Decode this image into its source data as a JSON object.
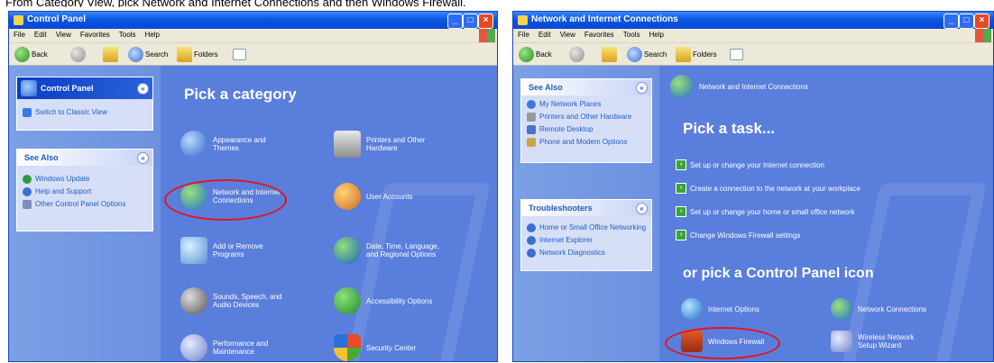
{
  "caption": "From Category View, pick Network and Internet Connections and then Windows Firewall.",
  "colors": {
    "xp_blue": "#5a7edc",
    "title_blue": "#0a56e0",
    "highlight_red": "#e3141e"
  },
  "left_window": {
    "title": "Control Panel",
    "menu": [
      "File",
      "Edit",
      "View",
      "Favorites",
      "Tools",
      "Help"
    ],
    "toolbar": {
      "back": "Back",
      "search": "Search",
      "folders": "Folders"
    },
    "control_panel_box": {
      "title": "Control Panel",
      "items": [
        "Switch to Classic View"
      ]
    },
    "see_also": {
      "title": "See Also",
      "items": [
        "Windows Update",
        "Help and Support",
        "Other Control Panel Options"
      ]
    },
    "heading": "Pick a category",
    "categories": [
      {
        "label": "Appearance and Themes",
        "icon": "appearance-icon"
      },
      {
        "label": "Printers and Other Hardware",
        "icon": "printer-icon"
      },
      {
        "label": "Network and Internet Connections",
        "icon": "network-globe-icon"
      },
      {
        "label": "User Accounts",
        "icon": "users-icon"
      },
      {
        "label": "Add or Remove Programs",
        "icon": "install-icon"
      },
      {
        "label": "Date, Time, Language, and Regional Options",
        "icon": "clock-globe-icon"
      },
      {
        "label": "Sounds, Speech, and Audio Devices",
        "icon": "speaker-icon"
      },
      {
        "label": "Accessibility Options",
        "icon": "accessibility-icon"
      },
      {
        "label": "Performance and Maintenance",
        "icon": "performance-icon"
      },
      {
        "label": "Security Center",
        "icon": "shield-icon"
      }
    ]
  },
  "right_window": {
    "title": "Network and Internet Connections",
    "menu": [
      "File",
      "Edit",
      "View",
      "Favorites",
      "Tools",
      "Help"
    ],
    "toolbar": {
      "back": "Back",
      "search": "Search",
      "folders": "Folders"
    },
    "see_also": {
      "title": "See Also",
      "items": [
        "My Network Places",
        "Printers and Other Hardware",
        "Remote Desktop",
        "Phone and Modem Options"
      ]
    },
    "troubleshooters": {
      "title": "Troubleshooters",
      "items": [
        "Home or Small Office Networking",
        "Internet Explorer",
        "Network Diagnostics"
      ]
    },
    "header_label": "Network and Internet Connections",
    "heading_task": "Pick a task...",
    "tasks": [
      "Set up or change your Internet connection",
      "Create a connection to the network at your workplace",
      "Set up or change your home or small office network",
      "Change Windows Firewall settings"
    ],
    "heading_icon": "or pick a Control Panel icon",
    "icons": [
      {
        "label": "Internet Options",
        "icon": "internet-options-icon"
      },
      {
        "label": "Network Connections",
        "icon": "network-connections-icon"
      },
      {
        "label": "Windows Firewall",
        "icon": "firewall-icon"
      },
      {
        "label": "Wireless Network Setup Wizard",
        "icon": "wireless-icon"
      }
    ]
  }
}
